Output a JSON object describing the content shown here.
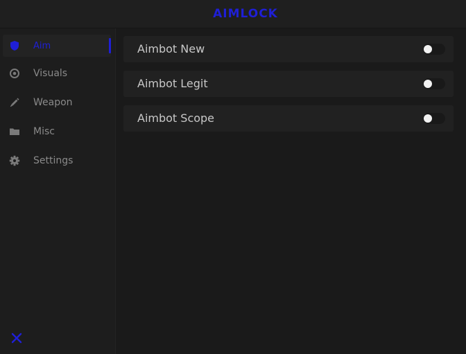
{
  "colors": {
    "accent": "#1f1fd6",
    "background": "#1a1a1a",
    "sidebar": "#1d1d1d",
    "option_bg": "#212121",
    "text_muted": "#8a8a8a"
  },
  "header": {
    "title": "AIMLOCK"
  },
  "sidebar": {
    "items": [
      {
        "label": "Aim",
        "icon": "shield-icon",
        "active": true
      },
      {
        "label": "Visuals",
        "icon": "eye-target-icon",
        "active": false
      },
      {
        "label": "Weapon",
        "icon": "syringe-icon",
        "active": false
      },
      {
        "label": "Misc",
        "icon": "folder-icon",
        "active": false
      },
      {
        "label": "Settings",
        "icon": "gear-icon",
        "active": false
      }
    ],
    "close_icon": "close-icon"
  },
  "main": {
    "options": [
      {
        "label": "Aimbot New",
        "enabled": false
      },
      {
        "label": "Aimbot Legit",
        "enabled": false
      },
      {
        "label": "Aimbot Scope",
        "enabled": false
      }
    ]
  }
}
